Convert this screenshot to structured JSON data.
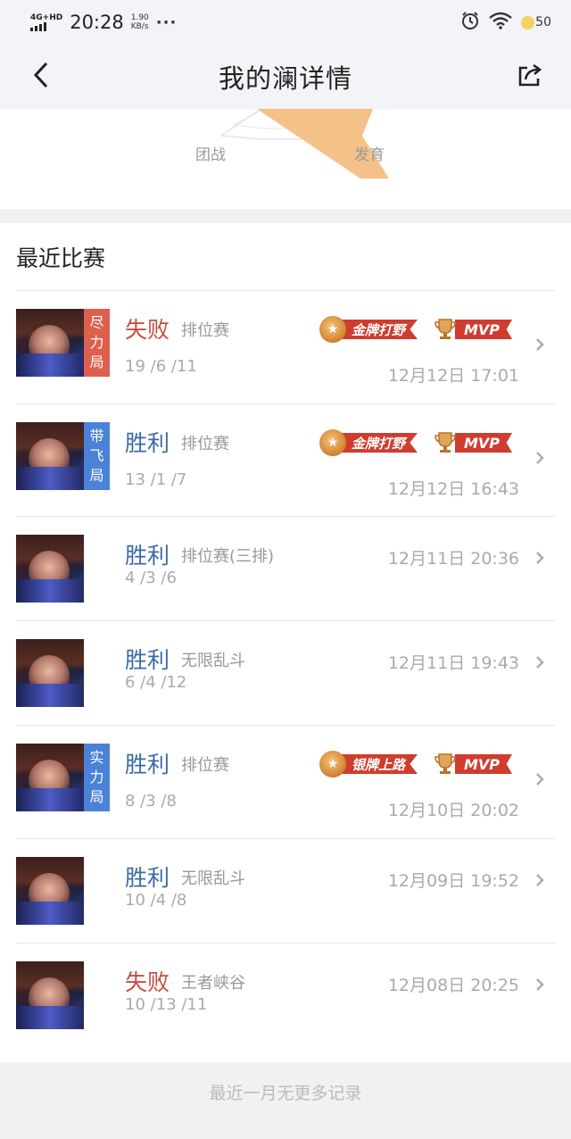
{
  "status_bar": {
    "network": "4G+HD",
    "time": "20:28",
    "speed_value": "1.90",
    "speed_unit": "KB/s",
    "dots": "···",
    "battery": "50",
    "icons": [
      "alarm-icon",
      "wifi-icon",
      "battery-icon"
    ]
  },
  "nav": {
    "title": "我的澜详情",
    "back_icon": "back-arrow-icon",
    "share_icon": "share-icon"
  },
  "radar": {
    "labels": {
      "team_fight": "团战",
      "development": "发育"
    },
    "fill_color": "#f3be82"
  },
  "section_title": "最近比赛",
  "matches": [
    {
      "result": "失败",
      "result_type": "lose",
      "mode": "排位赛",
      "kda": "19 /6 /11",
      "datetime": "12月12日 17:01",
      "tag": [
        "尽",
        "力",
        "局"
      ],
      "tag_color": "red",
      "badge": "金牌打野",
      "mvp": "MVP"
    },
    {
      "result": "胜利",
      "result_type": "win",
      "mode": "排位赛",
      "kda": "13 /1 /7",
      "datetime": "12月12日 16:43",
      "tag": [
        "带",
        "飞",
        "局"
      ],
      "tag_color": "blue",
      "badge": "金牌打野",
      "mvp": "MVP"
    },
    {
      "result": "胜利",
      "result_type": "win",
      "mode": "排位赛(三排)",
      "kda": "4 /3 /6",
      "datetime": "12月11日 20:36"
    },
    {
      "result": "胜利",
      "result_type": "win",
      "mode": "无限乱斗",
      "kda": "6 /4 /12",
      "datetime": "12月11日 19:43"
    },
    {
      "result": "胜利",
      "result_type": "win",
      "mode": "排位赛",
      "kda": "8 /3 /8",
      "datetime": "12月10日 20:02",
      "tag": [
        "实",
        "力",
        "局"
      ],
      "tag_color": "blue",
      "badge": "银牌上路",
      "mvp": "MVP"
    },
    {
      "result": "胜利",
      "result_type": "win",
      "mode": "无限乱斗",
      "kda": "10 /4 /8",
      "datetime": "12月09日 19:52"
    },
    {
      "result": "失败",
      "result_type": "lose",
      "mode": "王者峡谷",
      "kda": "10 /13 /11",
      "datetime": "12月08日 20:25"
    }
  ],
  "footer": "最近一月无更多记录",
  "colors": {
    "win": "#3a6aa8",
    "lose": "#c54e43",
    "tag_red": "#dd5f4d",
    "tag_blue": "#4a82d8",
    "badge_red": "#cf3d2f"
  }
}
